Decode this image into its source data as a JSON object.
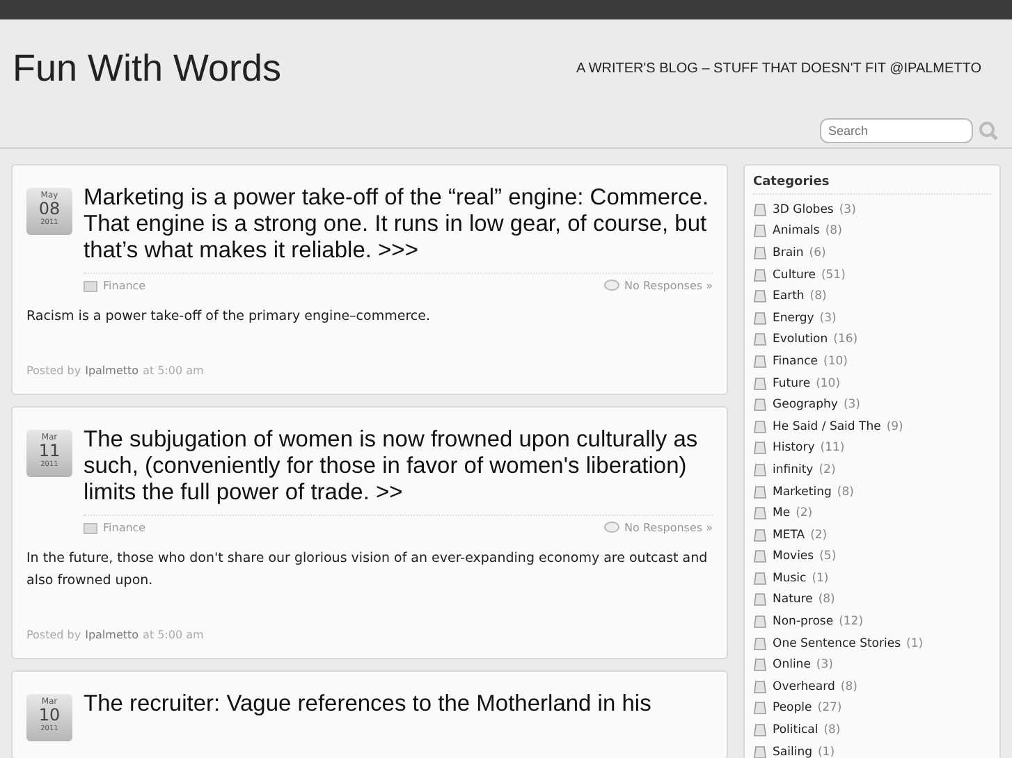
{
  "site": {
    "title": "Fun With Words",
    "tagline": "A WRITER'S BLOG – STUFF THAT DOESN'T FIT @IPALMETTO"
  },
  "search": {
    "placeholder": "Search"
  },
  "posts": [
    {
      "month": "May",
      "day": "08",
      "year": "2011",
      "title": "Marketing is a power take-off of the “real” engine: Commerce. That engine is a strong one. It runs in low gear, of course, but that’s what makes it reliable. >>>",
      "category": "Finance",
      "responses": "No Responses »",
      "body": "Racism is a power take-off of the primary engine–commerce.",
      "posted_by": "Posted by",
      "author": "Ipalmetto",
      "time": "at 5:00 am"
    },
    {
      "month": "Mar",
      "day": "11",
      "year": "2011",
      "title": "The subjugation of women is now frowned upon culturally as such, (conveniently for those in favor of women's liberation) limits the full power of trade. >>",
      "category": "Finance",
      "responses": "No Responses »",
      "body": "In the future, those who don't share our glorious vision of an ever-expanding economy are outcast and also frowned upon.",
      "posted_by": "Posted by",
      "author": "Ipalmetto",
      "time": "at 5:00 am"
    },
    {
      "month": "Mar",
      "day": "10",
      "year": "2011",
      "title": "The recruiter: Vague references to the Motherland in his"
    }
  ],
  "sidebar": {
    "heading": "Categories",
    "categories": [
      {
        "name": "3D Globes",
        "count": "(3)"
      },
      {
        "name": "Animals",
        "count": "(8)"
      },
      {
        "name": "Brain",
        "count": "(6)"
      },
      {
        "name": "Culture",
        "count": "(51)"
      },
      {
        "name": "Earth",
        "count": "(8)"
      },
      {
        "name": "Energy",
        "count": "(3)"
      },
      {
        "name": "Evolution",
        "count": "(16)"
      },
      {
        "name": "Finance",
        "count": "(10)"
      },
      {
        "name": "Future",
        "count": "(10)"
      },
      {
        "name": "Geography",
        "count": "(3)"
      },
      {
        "name": "He Said / Said The",
        "count": "(9)"
      },
      {
        "name": "History",
        "count": "(11)"
      },
      {
        "name": "infinity",
        "count": "(2)"
      },
      {
        "name": "Marketing",
        "count": "(8)"
      },
      {
        "name": "Me",
        "count": "(2)"
      },
      {
        "name": "META",
        "count": "(2)"
      },
      {
        "name": "Movies",
        "count": "(5)"
      },
      {
        "name": "Music",
        "count": "(1)"
      },
      {
        "name": "Nature",
        "count": "(8)"
      },
      {
        "name": "Non-prose",
        "count": "(12)"
      },
      {
        "name": "One Sentence Stories",
        "count": "(1)"
      },
      {
        "name": "Online",
        "count": "(3)"
      },
      {
        "name": "Overheard",
        "count": "(8)"
      },
      {
        "name": "People",
        "count": "(27)"
      },
      {
        "name": "Political",
        "count": "(8)"
      },
      {
        "name": "Sailing",
        "count": "(1)"
      }
    ]
  }
}
